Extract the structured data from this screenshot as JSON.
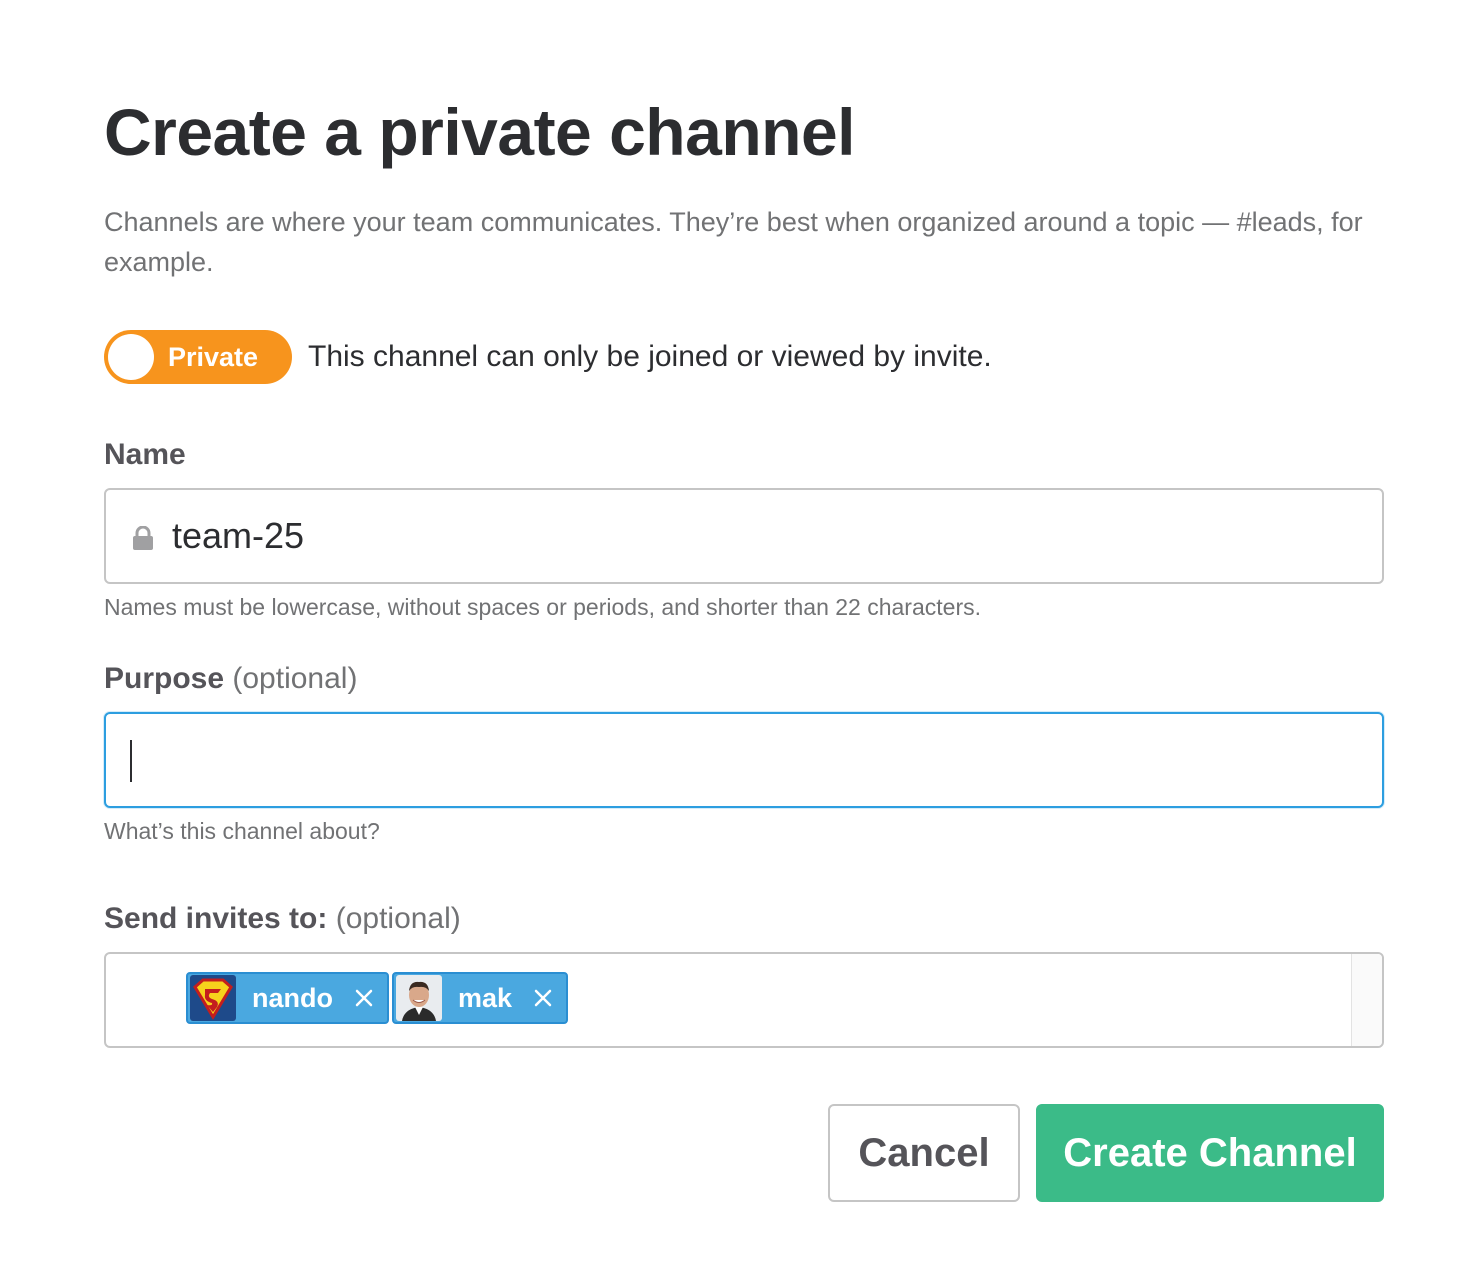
{
  "dialog": {
    "title": "Create a private channel",
    "description": "Channels are where your team communicates. They’re best when organized around a topic — #leads, for example."
  },
  "privacy": {
    "toggle_label": "Private",
    "toggle_on": true,
    "description": "This channel can only be joined or viewed by invite."
  },
  "name_field": {
    "label": "Name",
    "value": "team-25",
    "icon": "lock-icon",
    "hint": "Names must be lowercase, without spaces or periods, and shorter than 22 characters."
  },
  "purpose_field": {
    "label": "Purpose",
    "optional": "(optional)",
    "value": "",
    "hint": "What’s this channel about?"
  },
  "invites_field": {
    "label": "Send invites to:",
    "optional": "(optional)",
    "chips": [
      {
        "name": "nando",
        "avatar": "superman-logo"
      },
      {
        "name": "mak",
        "avatar": "user-photo"
      }
    ]
  },
  "actions": {
    "cancel_label": "Cancel",
    "create_label": "Create Channel"
  },
  "colors": {
    "toggle": "#f7941d",
    "chip": "#4aa8e0",
    "create_button": "#3bbb88",
    "focus_border": "#2d9ee0"
  }
}
